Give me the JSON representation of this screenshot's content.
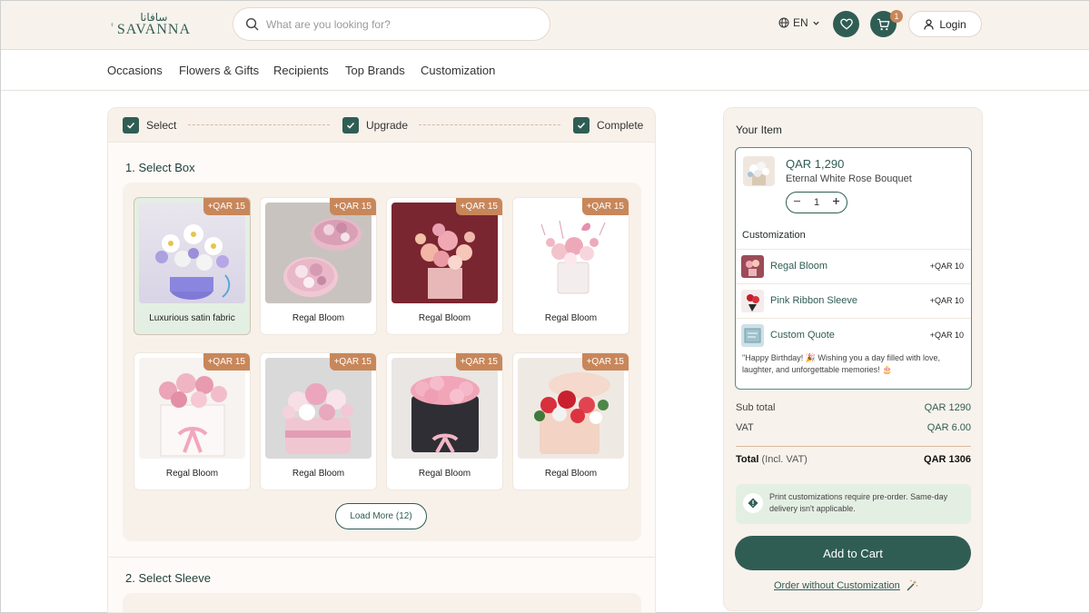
{
  "header": {
    "logo_arabic": "سافانا",
    "logo_text": "SAVANNA",
    "search_placeholder": "What are you looking for?",
    "language": "EN",
    "cart_count": "1",
    "login_label": "Login"
  },
  "nav": {
    "items": [
      "Occasions",
      "Flowers & Gifts",
      "Recipients",
      "Top Brands",
      "Customization"
    ]
  },
  "steps": [
    "Select",
    "Upgrade",
    "Complete"
  ],
  "sections": {
    "box_title": "1. Select Box",
    "sleeve_title": "2. Select Sleeve"
  },
  "boxes": [
    {
      "name": "Luxurious satin fabric",
      "price_tag": "+QAR 15",
      "selected": true
    },
    {
      "name": "Regal Bloom",
      "price_tag": "+QAR 15",
      "selected": false
    },
    {
      "name": "Regal Bloom",
      "price_tag": "+QAR 15",
      "selected": false
    },
    {
      "name": "Regal Bloom",
      "price_tag": "+QAR 15",
      "selected": false
    },
    {
      "name": "Regal Bloom",
      "price_tag": "+QAR 15",
      "selected": false
    },
    {
      "name": "Regal Bloom",
      "price_tag": "+QAR 15",
      "selected": false
    },
    {
      "name": "Regal Bloom",
      "price_tag": "+QAR 15",
      "selected": false
    },
    {
      "name": "Regal Bloom",
      "price_tag": "+QAR 15",
      "selected": false
    }
  ],
  "load_more_label": "Load More (12)",
  "cart_panel": {
    "title": "Your Item",
    "product_price": "QAR 1,290",
    "product_name": "Eternal White Rose Bouquet",
    "quantity": "1",
    "customization_title": "Customization",
    "customizations": [
      {
        "name": "Regal Bloom",
        "price": "+QAR 10"
      },
      {
        "name": "Pink Ribbon Sleeve",
        "price": "+QAR 10"
      },
      {
        "name": "Custom Quote",
        "price": "+QAR 10"
      }
    ],
    "message": "\"Happy Birthday! 🎉 Wishing you a day filled with love, laughter, and unforgettable memories! 🎂",
    "subtotal_label": "Sub total",
    "subtotal_value": "QAR 1290",
    "vat_label": "VAT",
    "vat_value": "QAR 6.00",
    "total_label": "Total",
    "total_suffix": "(Incl. VAT)",
    "total_value": "QAR 1306",
    "note": "Print customizations require pre-order. Same-day delivery isn't applicable.",
    "add_to_cart_label": "Add to Cart",
    "order_without_label": "Order without Customization"
  },
  "colors": {
    "brand_green": "#2f5d54",
    "accent_copper": "#c8875a",
    "cream": "#f8f2ec",
    "selected_green": "#e4efe3"
  }
}
